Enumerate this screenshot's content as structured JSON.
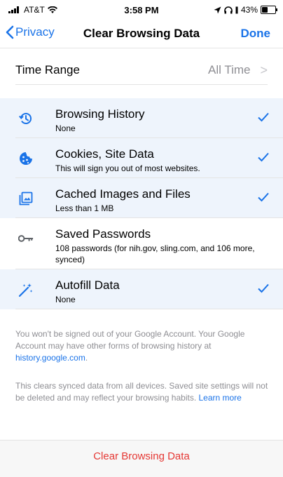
{
  "status_bar": {
    "carrier": "AT&T",
    "time": "3:58 PM",
    "battery": "43%"
  },
  "nav": {
    "back_label": "Privacy",
    "title": "Clear Browsing Data",
    "done_label": "Done"
  },
  "time_range": {
    "label": "Time Range",
    "value": "All Time",
    "chevron": ">"
  },
  "options": [
    {
      "icon": "history-icon",
      "title": "Browsing History",
      "subtitle": "None",
      "selected": true
    },
    {
      "icon": "cookie-icon",
      "title": "Cookies, Site Data",
      "subtitle": "This will sign you out of most websites.",
      "selected": true
    },
    {
      "icon": "image-icon",
      "title": "Cached Images and Files",
      "subtitle": "Less than 1 MB",
      "selected": true
    },
    {
      "icon": "key-icon",
      "title": "Saved Passwords",
      "subtitle": "108 passwords (for nih.gov, sling.com, and 106 more, synced)",
      "selected": false
    },
    {
      "icon": "magic-wand-icon",
      "title": "Autofill Data",
      "subtitle": "None",
      "selected": true
    }
  ],
  "footnotes": {
    "account_text": "You won't be signed out of your Google Account. Your Google Account may have other forms of browsing history at ",
    "account_link": "history.google.com",
    "account_end": ".",
    "sync_text": "This clears synced data from all devices. Saved site settings will not be deleted and may reflect your browsing habits. ",
    "sync_link": "Learn more"
  },
  "bottom": {
    "clear_label": "Clear Browsing Data"
  },
  "colors": {
    "accent": "#1a73e8",
    "destructive": "#e53935",
    "selected_row": "#eef4fc"
  }
}
